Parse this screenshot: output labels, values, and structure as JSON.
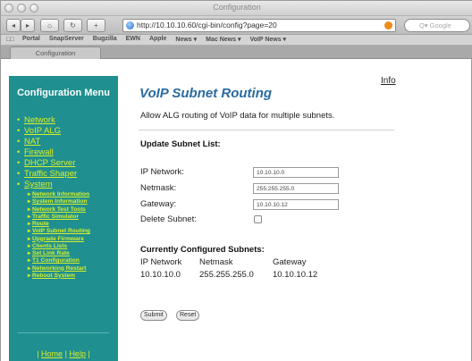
{
  "window": {
    "title": "Configuration"
  },
  "toolbar": {
    "back_label": "◂",
    "forward_label": "▸",
    "home_label": "⌂",
    "reload_label": "↻",
    "add_label": "+",
    "url": "http://10.10.10.60/cgi-bin/config?page=20",
    "search_placeholder": "Q▾ Google"
  },
  "bookmarks": {
    "icon": "□□",
    "items": [
      "Portal",
      "SnapServer",
      "Bugzilla",
      "EWN",
      "Apple",
      "News ▾",
      "Mac News ▾",
      "VoIP News ▾"
    ]
  },
  "tab": {
    "label": "Configuration"
  },
  "sidebar": {
    "title": "Configuration Menu",
    "items": [
      "Network",
      "VoIP ALG",
      "NAT",
      "Firewall",
      "DHCP Server",
      "Traffic Shaper",
      "System"
    ],
    "subitems": [
      "Network Information",
      "System Information",
      "Network Test Tools",
      "Traffic Simulator",
      "Route",
      "VoIP Subnet Routing",
      "Upgrade Firmware",
      "Clients Lists",
      "Set Link Rate",
      "T1 Configuration",
      "Networking Restart",
      "Reboot System"
    ],
    "footer_sep": "|",
    "footer_home": "Home",
    "footer_help": "Help"
  },
  "main": {
    "info_link": "Info",
    "title": "VoIP Subnet Routing",
    "description": "Allow ALG routing of VoIP data for multiple subnets.",
    "update_heading": "Update Subnet List:",
    "fields": {
      "ip_label": "IP Network:",
      "ip_value": "10.10.10.0",
      "netmask_label": "Netmask:",
      "netmask_value": "255.255.255.0",
      "gateway_label": "Gateway:",
      "gateway_value": "10.10.10.12",
      "delete_label": "Delete Subnet:"
    },
    "configured_heading": "Currently Configured Subnets:",
    "table": {
      "headers": [
        "IP Network",
        "Netmask",
        "Gateway"
      ],
      "rows": [
        [
          "10.10.10.0",
          "255.255.255.0",
          "10.10.10.12"
        ]
      ]
    },
    "submit_label": "Submit",
    "reset_label": "Reset"
  }
}
